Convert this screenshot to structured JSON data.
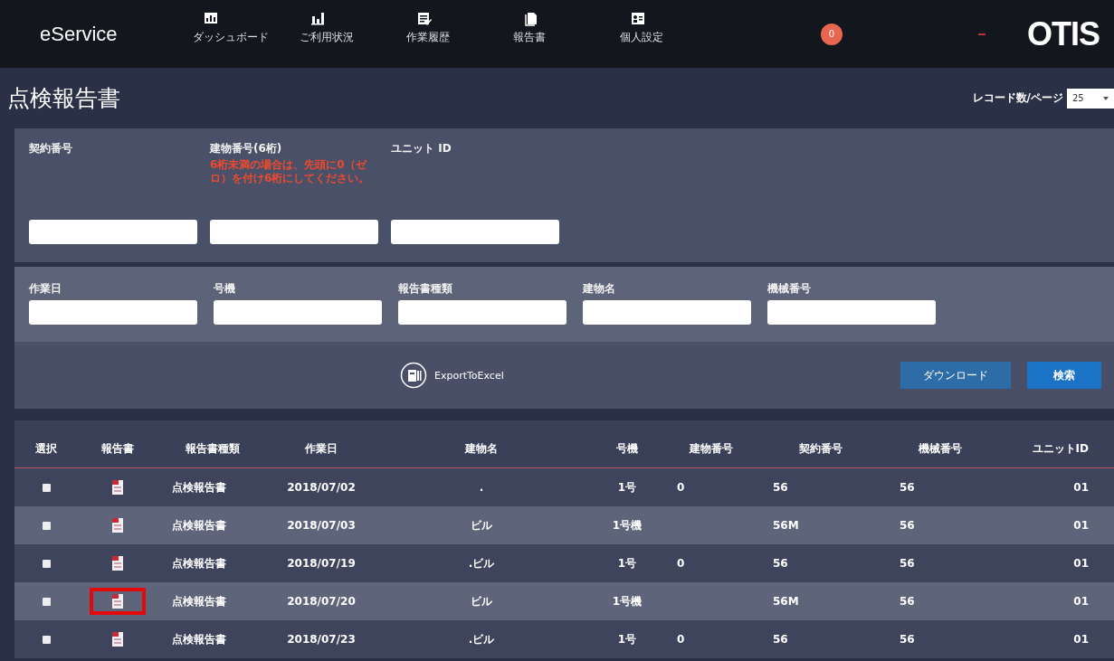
{
  "header": {
    "brand": "eService",
    "nav": [
      {
        "label": "ダッシュボード"
      },
      {
        "label": "ご利用状況"
      },
      {
        "label": "作業履歴"
      },
      {
        "label": "報告書"
      },
      {
        "label": "個人設定"
      }
    ],
    "badge": "0",
    "logo": "OTIS"
  },
  "page": {
    "title": "点検報告書",
    "page_size_label": "レコード数/ページ",
    "page_size": "25"
  },
  "filters_top": [
    {
      "label": "契約番号"
    },
    {
      "label": "建物番号(6桁)",
      "note": "6桁未満の場合は、先頭に0（ゼロ）を付け6桁にしてください。"
    },
    {
      "label": "ユニット ID"
    }
  ],
  "filters_bottom": [
    {
      "label": "作業日"
    },
    {
      "label": "号機"
    },
    {
      "label": "報告書種類"
    },
    {
      "label": "建物名"
    },
    {
      "label": "機械番号"
    }
  ],
  "actions": {
    "export": "ExportToExcel",
    "download": "ダウンロード",
    "search": "検索"
  },
  "table": {
    "columns": [
      "選択",
      "報告書",
      "報告書種類",
      "作業日",
      "建物名",
      "号機",
      "建物番号",
      "契約番号",
      "機械番号",
      "ユニットID"
    ],
    "rows": [
      {
        "checked": false,
        "highlighted": false,
        "type": "点検報告書",
        "date": "2018/07/02",
        "building": ".",
        "unit": "1号",
        "building_no": "0",
        "contract": "56",
        "machine": "56",
        "unit_id": "01"
      },
      {
        "checked": false,
        "highlighted": false,
        "type": "点検報告書",
        "date": "2018/07/03",
        "building": "ビル",
        "unit": "1号機",
        "contract": "56M",
        "machine": "56",
        "unit_id": "01"
      },
      {
        "checked": false,
        "highlighted": false,
        "type": "点検報告書",
        "date": "2018/07/19",
        "building": ".ビル",
        "unit": "1号",
        "building_no": "0",
        "contract": "56",
        "machine": "56",
        "unit_id": "01"
      },
      {
        "checked": false,
        "highlighted": true,
        "type": "点検報告書",
        "date": "2018/07/20",
        "building": "ビル",
        "unit": "1号機",
        "contract": "56M",
        "machine": "56",
        "unit_id": "01"
      },
      {
        "checked": false,
        "highlighted": false,
        "type": "点検報告書",
        "date": "2018/07/23",
        "building": ".ビル",
        "unit": "1号",
        "building_no": "0",
        "contract": "56",
        "machine": "56",
        "unit_id": "01"
      }
    ]
  }
}
